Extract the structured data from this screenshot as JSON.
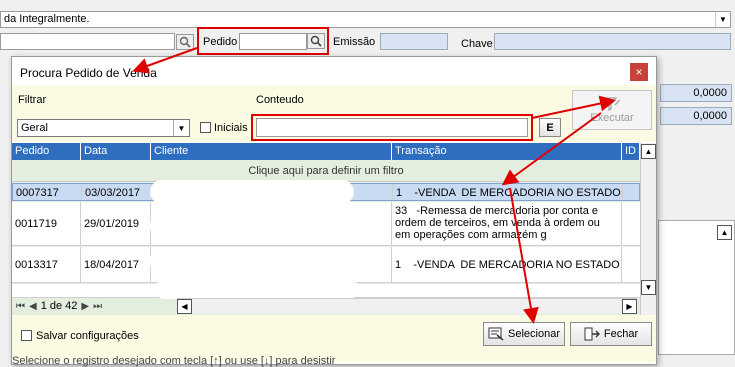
{
  "background": {
    "combo_value": "da Integralmente.",
    "pedido_label": "Pedido",
    "emissao_label": "Emissão",
    "chave_label": "Chave",
    "values": [
      "0,0000",
      "0,0000"
    ],
    "statusbar": "Selecione o registro desejado com tecla [↑] ou use [↓] para desistir"
  },
  "dialog": {
    "title": "Procura Pedido de Venda",
    "close": "×",
    "filtrar_label": "Filtrar",
    "conteudo_label": "Conteudo",
    "filtrar_value": "Geral",
    "iniciais_label": "Iniciais",
    "e_button": "E",
    "executar_label": "Executar",
    "grid": {
      "columns": [
        "Pedido",
        "Data",
        "Cliente",
        "Transação",
        "ID"
      ],
      "filter_hint": "Clique aqui para definir um filtro",
      "rows": [
        {
          "pedido": "0007317",
          "data": "03/03/2017",
          "transacao": "1    -VENDA  DE MERCADORIA NO ESTADO"
        },
        {
          "pedido": "0011719",
          "data": "29/01/2019",
          "transacao": "33   -Remessa de mercadoria por conta e ordem de terceiros, em venda à ordem ou em operações com armazém g"
        },
        {
          "pedido": "0013317",
          "data": "18/04/2017",
          "transacao": "1    -VENDA  DE MERCADORIA NO ESTADO"
        }
      ]
    },
    "pager": {
      "page_text": "1 de 42"
    },
    "salvar_label": "Salvar configurações",
    "selecionar_label": "Selecionar",
    "fechar_label": "Fechar"
  },
  "colors": {
    "accent": "#2f6ebf",
    "annotation": "#e00000",
    "filter_bg": "#fbfbe4"
  }
}
